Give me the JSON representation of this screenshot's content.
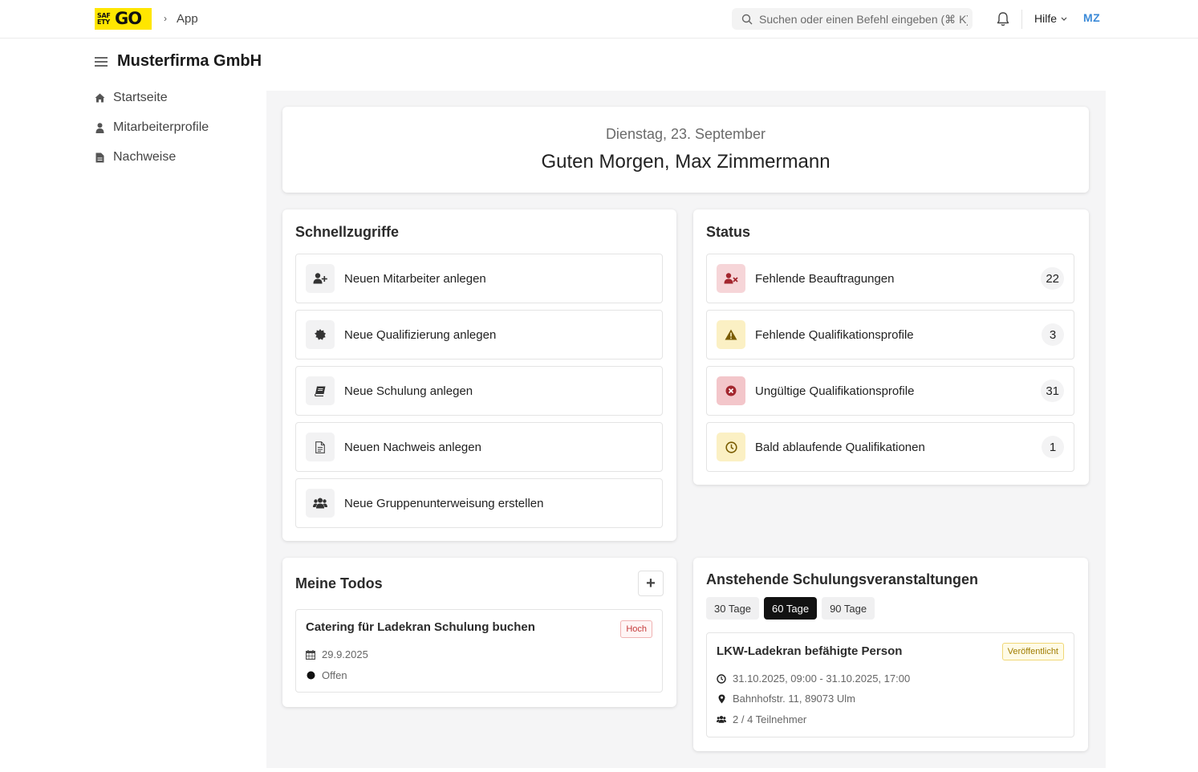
{
  "header": {
    "logo_small": "SAF ETY",
    "logo_big": "GO",
    "breadcrumb": "App",
    "search_placeholder": "Suchen oder einen Befehl eingeben (⌘ K)",
    "help_label": "Hilfe",
    "avatar_initials": "MZ"
  },
  "sidebar": {
    "company": "Musterfirma GmbH",
    "items": [
      {
        "label": "Startseite",
        "icon": "home-icon"
      },
      {
        "label": "Mitarbeiterprofile",
        "icon": "user-icon"
      },
      {
        "label": "Nachweise",
        "icon": "document-icon"
      }
    ]
  },
  "greeting": {
    "date": "Dienstag, 23. September",
    "text": "Guten Morgen, Max Zimmermann"
  },
  "quick_access": {
    "title": "Schnellzugriffe",
    "items": [
      {
        "label": "Neuen Mitarbeiter anlegen",
        "icon": "user-plus-icon"
      },
      {
        "label": "Neue Qualifizierung anlegen",
        "icon": "certificate-icon"
      },
      {
        "label": "Neue Schulung anlegen",
        "icon": "book-icon"
      },
      {
        "label": "Neuen Nachweis anlegen",
        "icon": "file-icon"
      },
      {
        "label": "Neue Gruppenunterweisung erstellen",
        "icon": "users-icon"
      }
    ]
  },
  "status": {
    "title": "Status",
    "items": [
      {
        "label": "Fehlende Beauftragungen",
        "count": "22",
        "icon": "user-x-icon",
        "color": "#f6d5d8",
        "icon_color": "#a3262e"
      },
      {
        "label": "Fehlende Qualifikationsprofile",
        "count": "3",
        "icon": "warning-icon",
        "color": "#fbf0c4",
        "icon_color": "#7a5c00"
      },
      {
        "label": "Ungültige Qualifikationsprofile",
        "count": "31",
        "icon": "x-circle-icon",
        "color": "#f3c6ca",
        "icon_color": "#a3262e"
      },
      {
        "label": "Bald ablaufende Qualifikationen",
        "count": "1",
        "icon": "clock-icon",
        "color": "#fbf0c4",
        "icon_color": "#7a5c00"
      }
    ]
  },
  "todos": {
    "title": "Meine Todos",
    "add_label": "+",
    "items": [
      {
        "title": "Catering für Ladekran Schulung buchen",
        "priority": "Hoch",
        "date": "29.9.2025",
        "state": "Offen"
      }
    ]
  },
  "events": {
    "title": "Anstehende Schulungsveranstaltungen",
    "tabs": [
      "30 Tage",
      "60 Tage",
      "90 Tage"
    ],
    "active_tab": "60 Tage",
    "items": [
      {
        "title": "LKW-Ladekran befähigte Person",
        "status": "Veröffentlicht",
        "time": "31.10.2025, 09:00 - 31.10.2025, 17:00",
        "location": "Bahnhofstr. 11, 89073 Ulm",
        "participants": "2 / 4 Teilnehmer"
      }
    ]
  }
}
